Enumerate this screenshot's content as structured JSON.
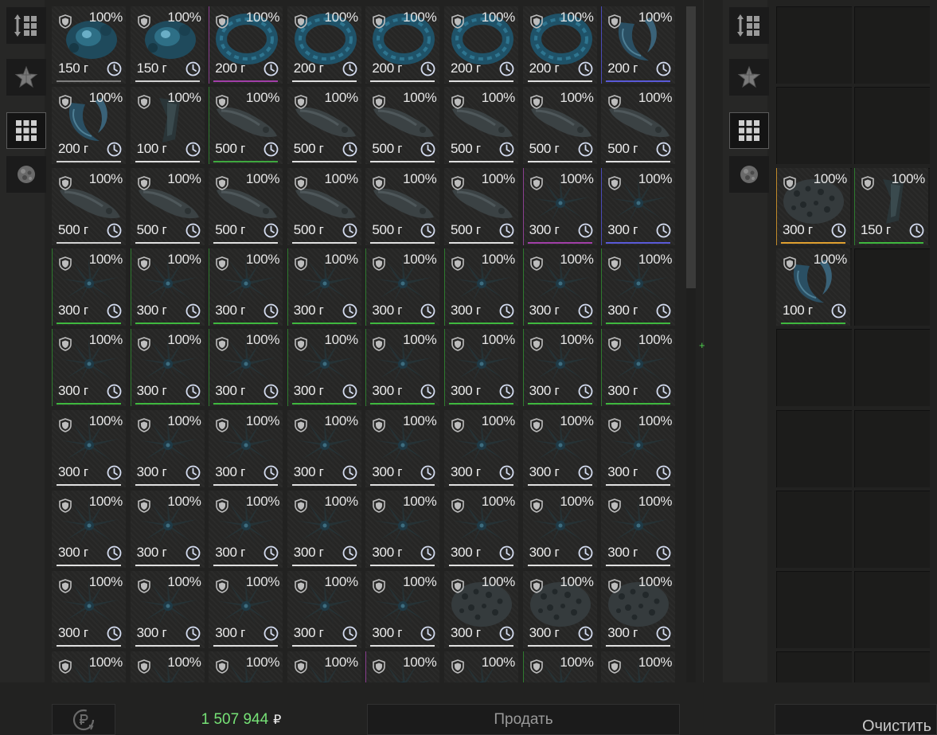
{
  "left_panel": {
    "toolbar": [
      {
        "icon": "sort-icon",
        "active": false
      },
      {
        "icon": "star-icon",
        "active": false
      },
      {
        "icon": "grid-icon",
        "active": true
      },
      {
        "icon": "artifact-icon",
        "active": false
      }
    ],
    "rows": [
      [
        {
          "art": "orb",
          "pct": "100%",
          "wt": "150 г",
          "bar": "#7f7f7f",
          "side": ""
        },
        {
          "art": "orb",
          "pct": "100%",
          "wt": "150 г",
          "bar": "#d2d2d2",
          "side": ""
        },
        {
          "art": "ring",
          "pct": "100%",
          "wt": "200 г",
          "bar": "#a23fa8",
          "side": "#8a3f8f"
        },
        {
          "art": "ring",
          "pct": "100%",
          "wt": "200 г",
          "bar": "#e0e0e0",
          "side": ""
        },
        {
          "art": "ring",
          "pct": "100%",
          "wt": "200 г",
          "bar": "#e0e0e0",
          "side": ""
        },
        {
          "art": "ring",
          "pct": "100%",
          "wt": "200 г",
          "bar": "#e0e0e0",
          "side": ""
        },
        {
          "art": "ring",
          "pct": "100%",
          "wt": "200 г",
          "bar": "#e0e0e0",
          "side": ""
        },
        {
          "art": "crescent",
          "pct": "100%",
          "wt": "200 г",
          "bar": "#5a5ad8",
          "side": "#4b4bb8"
        }
      ],
      [
        {
          "art": "crescent",
          "pct": "100%",
          "wt": "200 г",
          "bar": "#d2d2d2",
          "side": ""
        },
        {
          "art": "shard",
          "pct": "100%",
          "wt": "100 г",
          "bar": "#e0e0e0",
          "side": ""
        },
        {
          "art": "rock",
          "pct": "100%",
          "wt": "500 г",
          "bar": "#3fa83f",
          "side": "#2f7a2f"
        },
        {
          "art": "rock",
          "pct": "100%",
          "wt": "500 г",
          "bar": "#e0e0e0",
          "side": ""
        },
        {
          "art": "rock",
          "pct": "100%",
          "wt": "500 г",
          "bar": "#e0e0e0",
          "side": ""
        },
        {
          "art": "rock",
          "pct": "100%",
          "wt": "500 г",
          "bar": "#e0e0e0",
          "side": ""
        },
        {
          "art": "rock",
          "pct": "100%",
          "wt": "500 г",
          "bar": "#e0e0e0",
          "side": ""
        },
        {
          "art": "rock",
          "pct": "100%",
          "wt": "500 г",
          "bar": "#e0e0e0",
          "side": ""
        }
      ],
      [
        {
          "art": "rock",
          "pct": "100%",
          "wt": "500 г",
          "bar": "#d2d2d2",
          "side": ""
        },
        {
          "art": "rock",
          "pct": "100%",
          "wt": "500 г",
          "bar": "#e0e0e0",
          "side": ""
        },
        {
          "art": "rock",
          "pct": "100%",
          "wt": "500 г",
          "bar": "#e0e0e0",
          "side": ""
        },
        {
          "art": "rock",
          "pct": "100%",
          "wt": "500 г",
          "bar": "#e0e0e0",
          "side": ""
        },
        {
          "art": "rock",
          "pct": "100%",
          "wt": "500 г",
          "bar": "#e0e0e0",
          "side": ""
        },
        {
          "art": "rock",
          "pct": "100%",
          "wt": "500 г",
          "bar": "#e0e0e0",
          "side": ""
        },
        {
          "art": "flower",
          "pct": "100%",
          "wt": "300 г",
          "bar": "#a23fa8",
          "side": "#8a3f8f"
        },
        {
          "art": "flower",
          "pct": "100%",
          "wt": "300 г",
          "bar": "#5a5ad8",
          "side": "#4b4bb8"
        }
      ],
      [
        {
          "art": "flower",
          "pct": "100%",
          "wt": "300 г",
          "bar": "#3fb83f",
          "side": "#2f7a2f"
        },
        {
          "art": "flower",
          "pct": "100%",
          "wt": "300 г",
          "bar": "#3fb83f",
          "side": "#2f7a2f"
        },
        {
          "art": "flower",
          "pct": "100%",
          "wt": "300 г",
          "bar": "#3fb83f",
          "side": "#2f7a2f"
        },
        {
          "art": "flower",
          "pct": "100%",
          "wt": "300 г",
          "bar": "#3fb83f",
          "side": "#2f7a2f"
        },
        {
          "art": "flower",
          "pct": "100%",
          "wt": "300 г",
          "bar": "#3fb83f",
          "side": "#2f7a2f"
        },
        {
          "art": "flower",
          "pct": "100%",
          "wt": "300 г",
          "bar": "#3fb83f",
          "side": "#2f7a2f"
        },
        {
          "art": "flower",
          "pct": "100%",
          "wt": "300 г",
          "bar": "#3fb83f",
          "side": "#2f7a2f"
        },
        {
          "art": "flower",
          "pct": "100%",
          "wt": "300 г",
          "bar": "#3fb83f",
          "side": "#2f7a2f"
        }
      ],
      [
        {
          "art": "flower",
          "pct": "100%",
          "wt": "300 г",
          "bar": "#3fb83f",
          "side": "#2f7a2f"
        },
        {
          "art": "flower",
          "pct": "100%",
          "wt": "300 г",
          "bar": "#3fb83f",
          "side": "#2f7a2f"
        },
        {
          "art": "flower",
          "pct": "100%",
          "wt": "300 г",
          "bar": "#3fb83f",
          "side": "#2f7a2f"
        },
        {
          "art": "flower",
          "pct": "100%",
          "wt": "300 г",
          "bar": "#3fb83f",
          "side": "#2f7a2f"
        },
        {
          "art": "flower",
          "pct": "100%",
          "wt": "300 г",
          "bar": "#3fb83f",
          "side": "#2f7a2f"
        },
        {
          "art": "flower",
          "pct": "100%",
          "wt": "300 г",
          "bar": "#3fb83f",
          "side": "#2f7a2f"
        },
        {
          "art": "flower",
          "pct": "100%",
          "wt": "300 г",
          "bar": "#3fb83f",
          "side": "#2f7a2f"
        },
        {
          "art": "flower",
          "pct": "100%",
          "wt": "300 г",
          "bar": "#3fb83f",
          "side": "#2f7a2f"
        }
      ],
      [
        {
          "art": "flower",
          "pct": "100%",
          "wt": "300 г",
          "bar": "#e0e0e0",
          "side": ""
        },
        {
          "art": "flower",
          "pct": "100%",
          "wt": "300 г",
          "bar": "#e0e0e0",
          "side": ""
        },
        {
          "art": "flower",
          "pct": "100%",
          "wt": "300 г",
          "bar": "#e0e0e0",
          "side": ""
        },
        {
          "art": "flower",
          "pct": "100%",
          "wt": "300 г",
          "bar": "#e0e0e0",
          "side": ""
        },
        {
          "art": "flower",
          "pct": "100%",
          "wt": "300 г",
          "bar": "#e0e0e0",
          "side": ""
        },
        {
          "art": "flower",
          "pct": "100%",
          "wt": "300 г",
          "bar": "#e0e0e0",
          "side": ""
        },
        {
          "art": "flower",
          "pct": "100%",
          "wt": "300 г",
          "bar": "#e0e0e0",
          "side": ""
        },
        {
          "art": "flower",
          "pct": "100%",
          "wt": "300 г",
          "bar": "#e0e0e0",
          "side": ""
        }
      ],
      [
        {
          "art": "flower",
          "pct": "100%",
          "wt": "300 г",
          "bar": "#e0e0e0",
          "side": ""
        },
        {
          "art": "flower",
          "pct": "100%",
          "wt": "300 г",
          "bar": "#e0e0e0",
          "side": ""
        },
        {
          "art": "flower",
          "pct": "100%",
          "wt": "300 г",
          "bar": "#e0e0e0",
          "side": ""
        },
        {
          "art": "flower",
          "pct": "100%",
          "wt": "300 г",
          "bar": "#e0e0e0",
          "side": ""
        },
        {
          "art": "flower",
          "pct": "100%",
          "wt": "300 г",
          "bar": "#e0e0e0",
          "side": ""
        },
        {
          "art": "flower",
          "pct": "100%",
          "wt": "300 г",
          "bar": "#e0e0e0",
          "side": ""
        },
        {
          "art": "flower",
          "pct": "100%",
          "wt": "300 г",
          "bar": "#e0e0e0",
          "side": ""
        },
        {
          "art": "flower",
          "pct": "100%",
          "wt": "300 г",
          "bar": "#e0e0e0",
          "side": ""
        }
      ],
      [
        {
          "art": "flower",
          "pct": "100%",
          "wt": "300 г",
          "bar": "#e0e0e0",
          "side": ""
        },
        {
          "art": "flower",
          "pct": "100%",
          "wt": "300 г",
          "bar": "#e0e0e0",
          "side": ""
        },
        {
          "art": "flower",
          "pct": "100%",
          "wt": "300 г",
          "bar": "#e0e0e0",
          "side": ""
        },
        {
          "art": "flower",
          "pct": "100%",
          "wt": "300 г",
          "bar": "#e0e0e0",
          "side": ""
        },
        {
          "art": "flower",
          "pct": "100%",
          "wt": "300 г",
          "bar": "#e0e0e0",
          "side": ""
        },
        {
          "art": "sponge",
          "pct": "100%",
          "wt": "300 г",
          "bar": "#e0e0e0",
          "side": ""
        },
        {
          "art": "sponge",
          "pct": "100%",
          "wt": "300 г",
          "bar": "#e0e0e0",
          "side": ""
        },
        {
          "art": "sponge",
          "pct": "100%",
          "wt": "300 г",
          "bar": "#e0e0e0",
          "side": ""
        }
      ],
      [
        {
          "art": "flower",
          "pct": "100%",
          "wt": "",
          "bar": "",
          "side": ""
        },
        {
          "art": "flower",
          "pct": "100%",
          "wt": "",
          "bar": "",
          "side": ""
        },
        {
          "art": "flower",
          "pct": "100%",
          "wt": "",
          "bar": "",
          "side": ""
        },
        {
          "art": "flower",
          "pct": "100%",
          "wt": "",
          "bar": "",
          "side": ""
        },
        {
          "art": "flower",
          "pct": "100%",
          "wt": "",
          "bar": "",
          "side": "#8a3f8f"
        },
        {
          "art": "flower",
          "pct": "100%",
          "wt": "",
          "bar": "",
          "side": ""
        },
        {
          "art": "flower",
          "pct": "100%",
          "wt": "",
          "bar": "",
          "side": "#2f7a2f"
        },
        {
          "art": "flower",
          "pct": "100%",
          "wt": "",
          "bar": "",
          "side": ""
        }
      ]
    ],
    "money": "1 507 944",
    "currency": "₽",
    "sell_label": "Продать",
    "refresh_icon": "ruble-refresh-icon"
  },
  "right_panel": {
    "toolbar": [
      {
        "icon": "sort-icon",
        "active": false
      },
      {
        "icon": "star-icon",
        "active": false
      },
      {
        "icon": "grid-icon",
        "active": true
      },
      {
        "icon": "artifact-icon",
        "active": false
      }
    ],
    "items": [
      {
        "art": "sponge",
        "pct": "100%",
        "wt": "300 г",
        "bar": "#e0a030",
        "side": "#c08a2a"
      },
      {
        "art": "shard",
        "pct": "100%",
        "wt": "150 г",
        "bar": "#3fb83f",
        "side": "#2f7a2f"
      },
      {
        "art": "crescent",
        "pct": "100%",
        "wt": "100 г",
        "bar": "#3fb83f",
        "side": ""
      }
    ],
    "clear_label": "Очистить"
  },
  "colors": {
    "money_green": "#76e276",
    "background": "#222221"
  }
}
